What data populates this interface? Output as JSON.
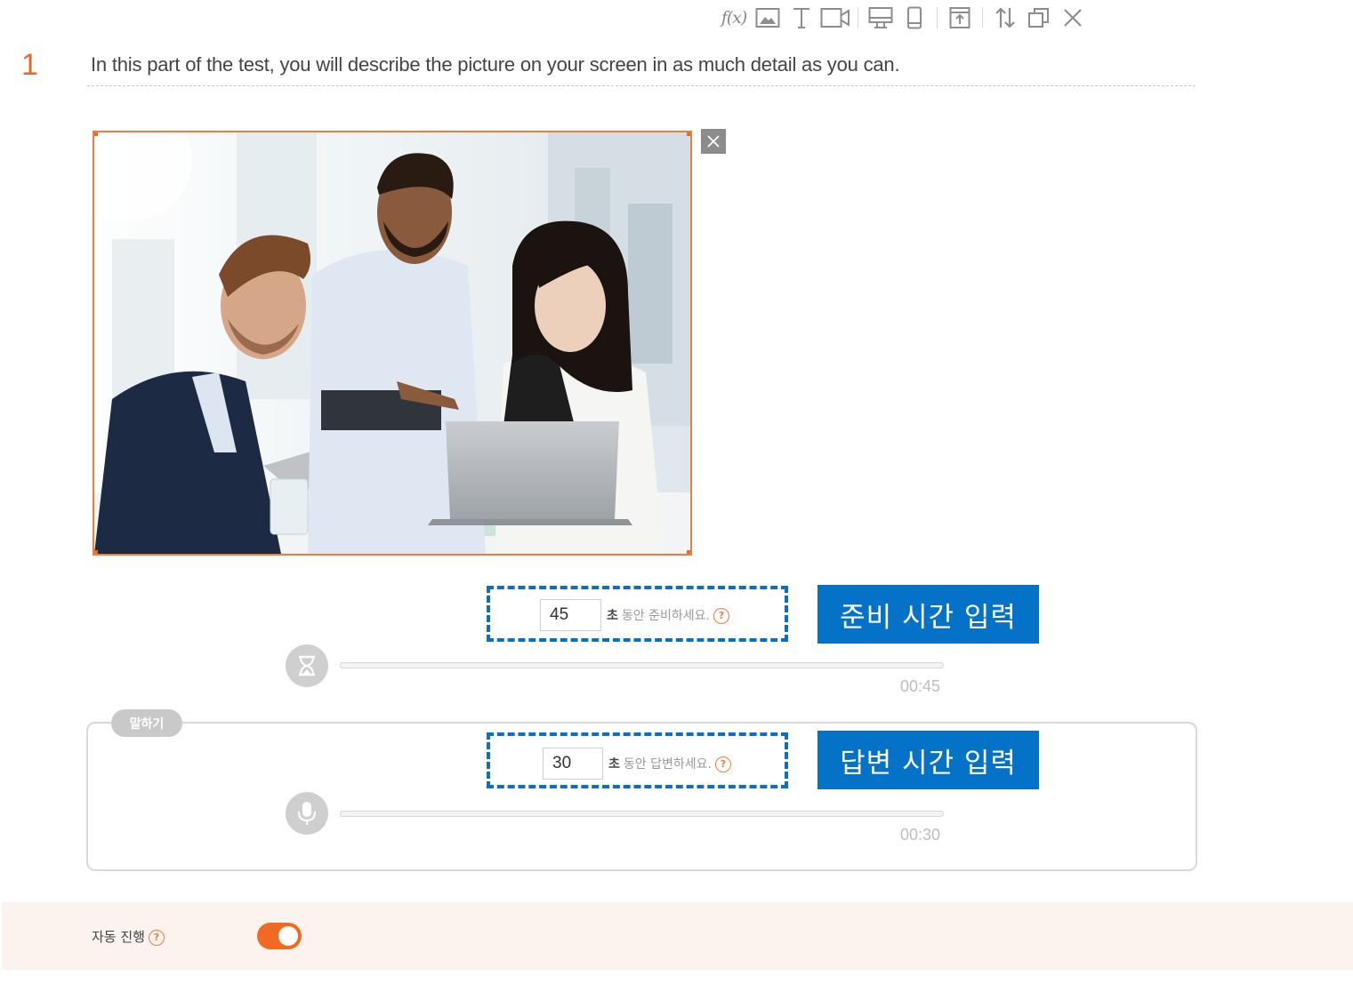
{
  "toolbar": {
    "items": [
      {
        "name": "formula",
        "label": "f(x)"
      },
      {
        "name": "image"
      },
      {
        "name": "text"
      },
      {
        "name": "video"
      },
      {
        "name": "desktop-view"
      },
      {
        "name": "mobile-view"
      },
      {
        "name": "export"
      },
      {
        "name": "sort"
      },
      {
        "name": "duplicate"
      },
      {
        "name": "close"
      }
    ]
  },
  "question": {
    "number": "1",
    "text": "In this part of the test, you will describe the picture on your screen in as much detail as you can."
  },
  "image": {
    "description": "photo-business-meeting"
  },
  "prep": {
    "seconds": "45",
    "unit": "초",
    "label": "동안 준비하세요.",
    "help": "?",
    "tag": "준비 시간 입력",
    "timer": "00:45"
  },
  "speaking": {
    "badge": "말하기",
    "seconds": "30",
    "unit": "초",
    "label": "동안 답변하세요.",
    "help": "?",
    "tag": "답변 시간 입력",
    "timer": "00:30"
  },
  "footer": {
    "auto_label": "자동 진행",
    "help": "?",
    "auto_enabled": true
  },
  "colors": {
    "accent": "#f06a22",
    "highlight_blue": "#0372c7"
  }
}
